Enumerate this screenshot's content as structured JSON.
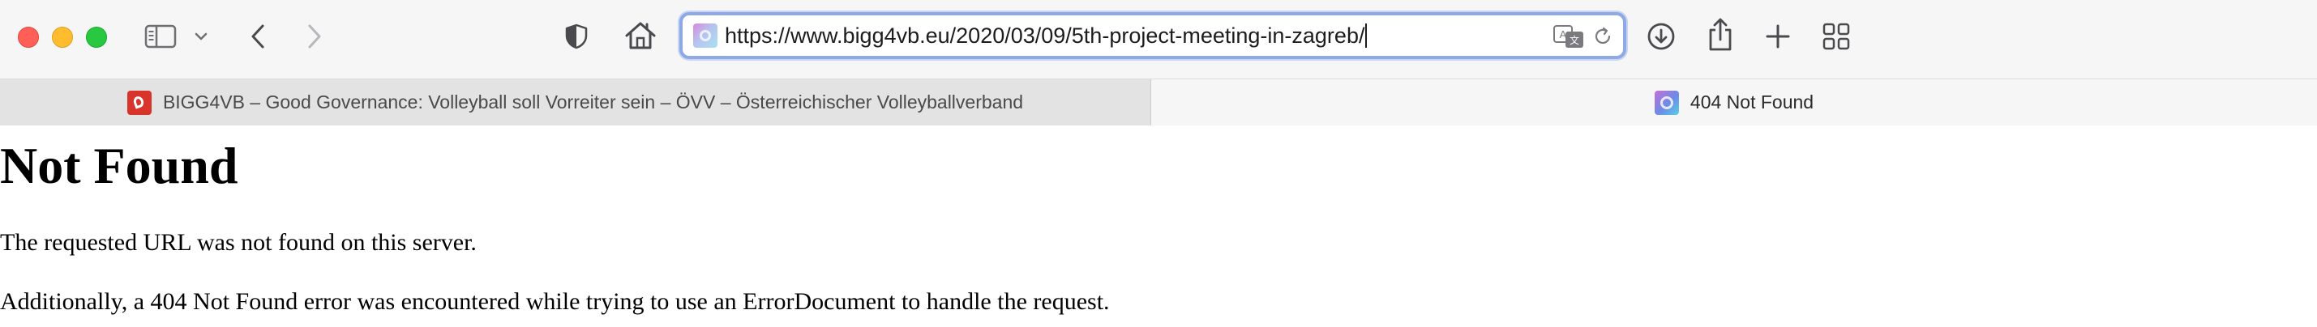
{
  "browser": {
    "address_bar": {
      "url": "https://www.bigg4vb.eu/2020/03/09/5th-project-meeting-in-zagreb/"
    },
    "toolbar_icons": [
      "sidebar-icon",
      "chevron-down-icon",
      "back-icon",
      "forward-icon",
      "privacy-shield-icon",
      "home-icon",
      "translate-icon",
      "reload-icon",
      "downloads-icon",
      "share-icon",
      "new-tab-icon",
      "tab-overview-icon"
    ],
    "tabs": [
      {
        "title": "BIGG4VB – Good Governance: Volleyball soll Vorreiter sein – ÖVV – Österreichischer Volleyballverband",
        "active": false
      },
      {
        "title": "404 Not Found",
        "active": true
      }
    ]
  },
  "page": {
    "heading": "Not Found",
    "message": "The requested URL was not found on this server.",
    "detail": "Additionally, a 404 Not Found error was encountered while trying to use an ErrorDocument to handle the request."
  },
  "colors": {
    "close": "#ff5f57",
    "minimize": "#febc2e",
    "zoom": "#28c840",
    "focus_ring": "#8fa9e6"
  }
}
